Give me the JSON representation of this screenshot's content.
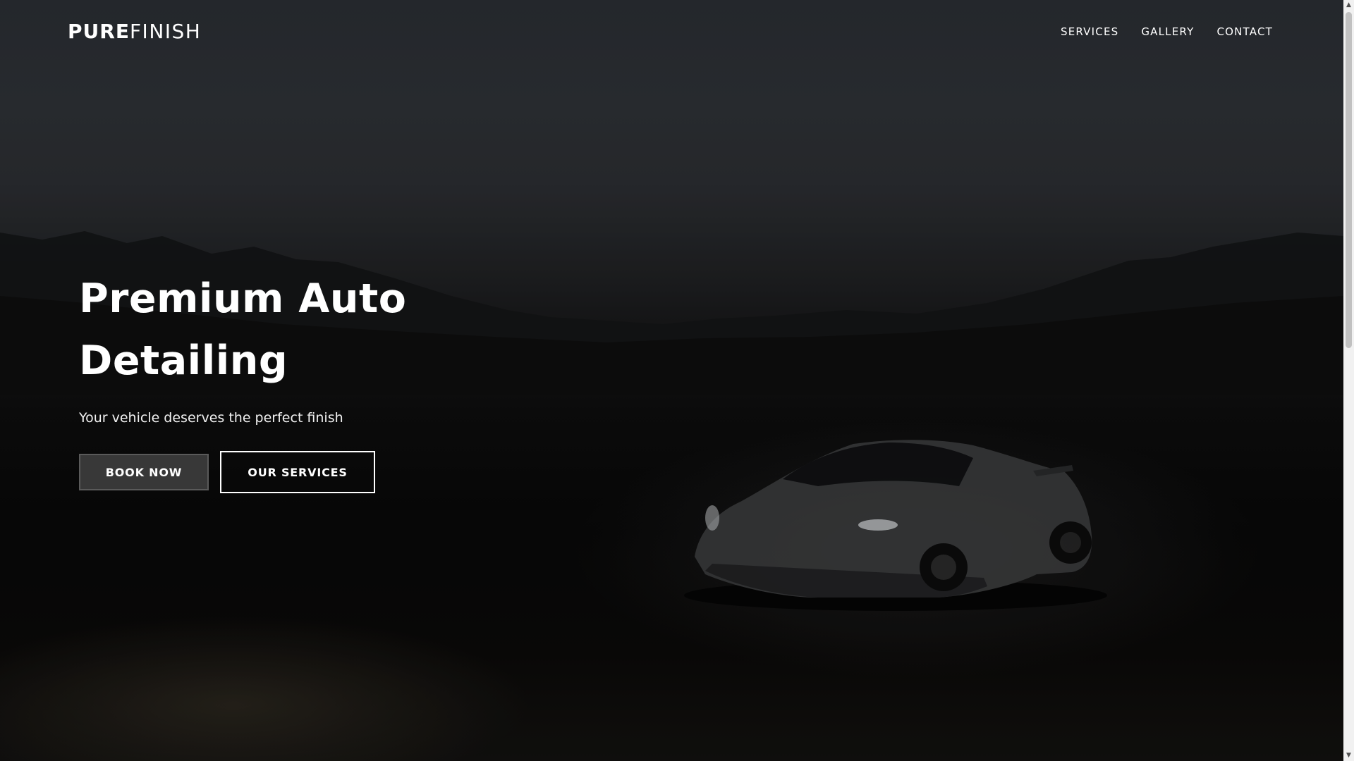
{
  "header": {
    "logo_bold": "PURE",
    "logo_light": "FINISH",
    "nav": [
      {
        "label": "SERVICES"
      },
      {
        "label": "GALLERY"
      },
      {
        "label": "CONTACT"
      }
    ]
  },
  "hero": {
    "title_line1": "Premium Auto",
    "title_line2": "Detailing",
    "subtitle": "Your vehicle deserves the perfect finish",
    "primary_button": "BOOK NOW",
    "secondary_button": "OUR SERVICES",
    "background_image": "dark-sports-car-night-landscape"
  },
  "scrollbar": {
    "up_icon": "triangle-up-icon",
    "down_icon": "triangle-down-icon",
    "scroll_position": 0
  },
  "colors": {
    "text": "#ffffff",
    "primary_button_bg": "#383838",
    "page_bg": "#000000"
  }
}
